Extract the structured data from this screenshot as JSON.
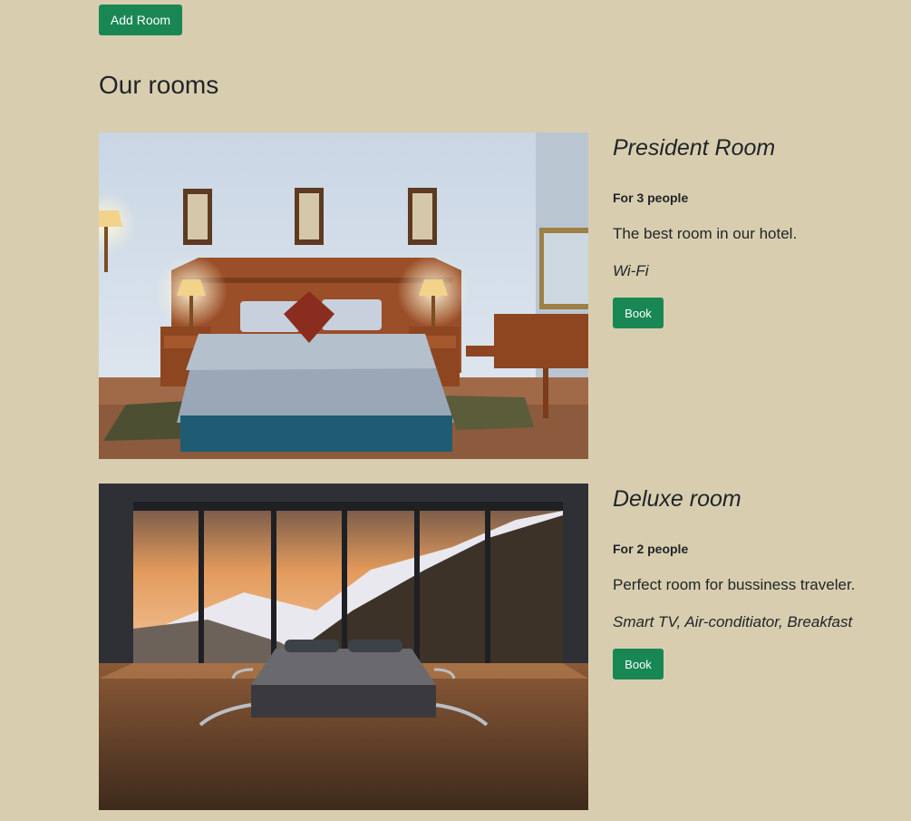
{
  "toolbar": {
    "add_room_label": "Add Room"
  },
  "section": {
    "title": "Our rooms"
  },
  "rooms": [
    {
      "name": "President Room",
      "capacity": "For 3 people",
      "description": "The best room in our hotel.",
      "amenities": "Wi-Fi",
      "book_label": "Book",
      "photo": "hotel-bedroom-photo"
    },
    {
      "name": "Deluxe room",
      "capacity": "For 2 people",
      "description": "Perfect room for bussiness traveler.",
      "amenities": "Smart TV, Air-conditiator, Breakfast",
      "book_label": "Book",
      "photo": "mountain-view-bedroom-photo"
    }
  ],
  "colors": {
    "page_background": "#d8ceaf",
    "button": "#198754",
    "button_text": "#ffffff",
    "text": "#212529"
  }
}
